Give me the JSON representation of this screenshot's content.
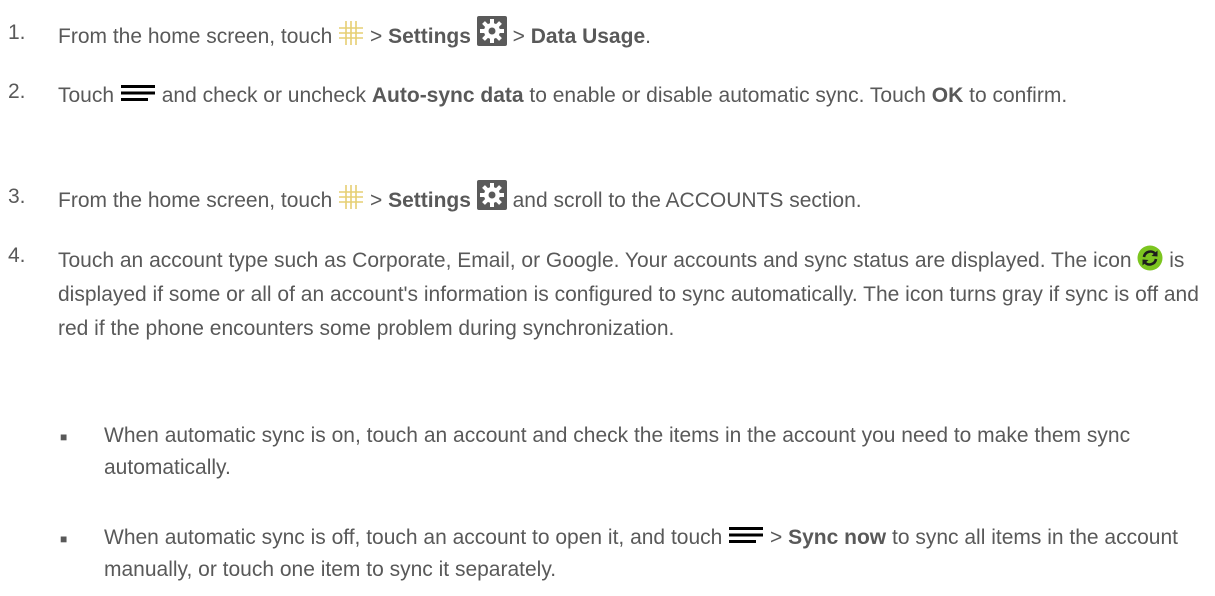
{
  "steps": [
    {
      "number": "1.",
      "parts": {
        "a": "From the home screen, touch",
        "b": ">",
        "settings": "Settings",
        "c": ">",
        "data_usage": "Data Usage",
        "d": "."
      }
    },
    {
      "number": "2.",
      "parts": {
        "a": "Touch",
        "b": "and check or uncheck",
        "autosync": "Auto-sync data",
        "c": "to enable or disable automatic sync. Touch",
        "ok": "OK",
        "d": "to confirm."
      }
    },
    {
      "number": "3.",
      "parts": {
        "a": "From the home screen, touch",
        "b": ">",
        "settings": "Settings",
        "c": "and scroll to the ACCOUNTS section."
      }
    },
    {
      "number": "4.",
      "parts": {
        "a": "Touch an account type such as Corporate, Email, or Google. Your accounts and sync status are displayed. The icon",
        "b": "is displayed if some or all of an account's information is configured to sync automatically. The icon turns gray if sync is off and red if the phone encounters some problem during synchronization."
      }
    }
  ],
  "bullets": [
    {
      "text": "When automatic sync is on, touch an account and check the items in the account you need to make them sync automatically."
    },
    {
      "a": "When automatic sync is off, touch an account to open it, and touch",
      "b": ">",
      "sync_now": "Sync now",
      "c": "to sync all items in the account manually, or touch one item to sync it separately."
    }
  ],
  "icons": {
    "apps": "apps-grid-icon",
    "settings": "settings-gear-icon",
    "menu": "menu-icon",
    "sync": "sync-icon"
  },
  "colors": {
    "text": "#595959",
    "sync_icon": "#7bc41f",
    "apps_grid": "#e8d070",
    "settings_bg": "#5b5b5b"
  }
}
